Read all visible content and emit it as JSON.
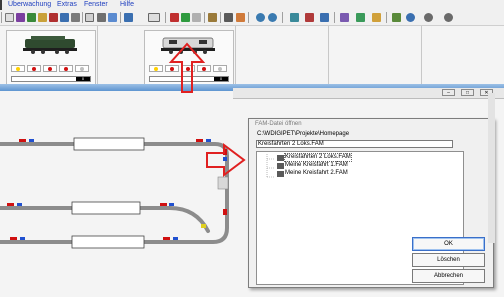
{
  "menubar": {
    "items": [
      "Überwachung",
      "Extras",
      "Fenster",
      "Hilfe"
    ]
  },
  "locos": [
    {
      "speed": "0"
    },
    {
      "speed": "0"
    }
  ],
  "dialog": {
    "title": "FAM-Datei öffnen",
    "path": "C:\\WDIGIPET\\Projekte\\Homepage",
    "filename": "Kreisfahrten 2 Loks.FAM",
    "files": [
      "Kreisfahrten 2 Loks.FAM",
      "Meine Kreisfahrt 1.FAM",
      "Meine Kreisfahrt 2.FAM"
    ],
    "ok_label": "OK",
    "delete_label": "Löschen",
    "cancel_label": "Abbrechen"
  },
  "colors": {
    "arrow": "#e02020",
    "titlebar": "#6f9fd6",
    "track": "#8c8c8c"
  }
}
